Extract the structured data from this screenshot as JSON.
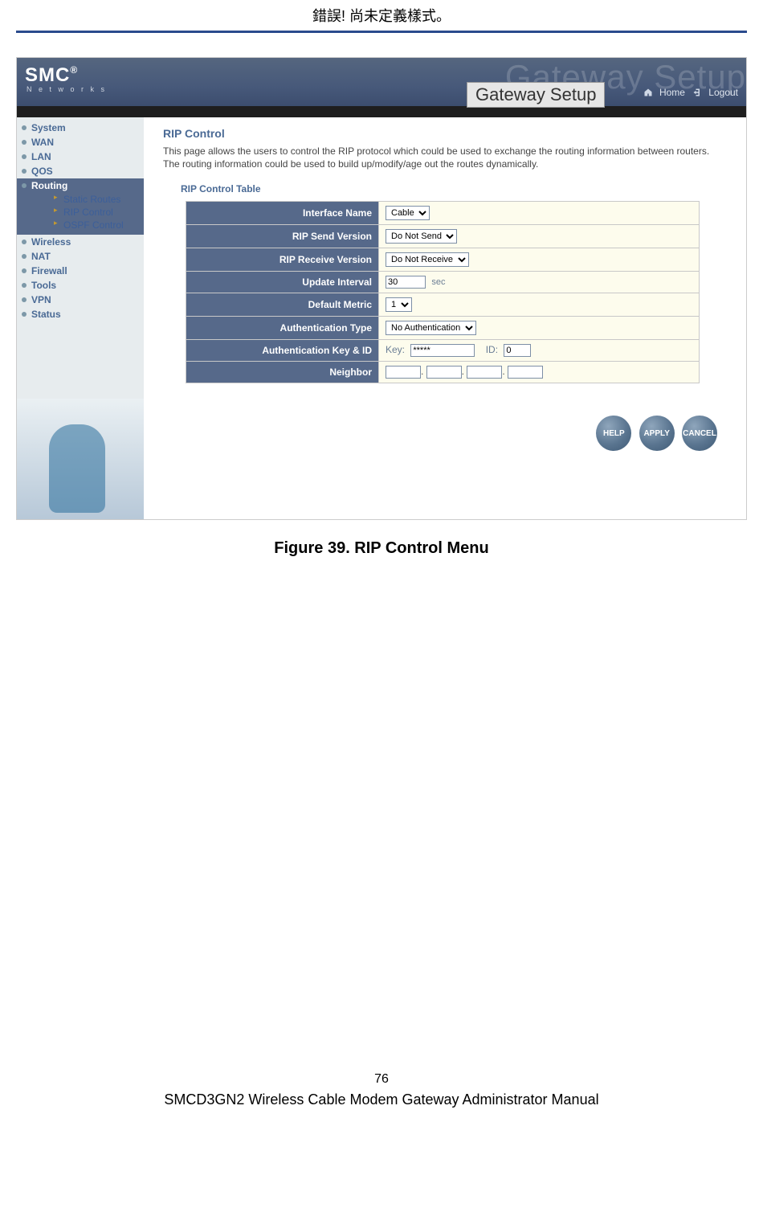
{
  "doc": {
    "topWarning": "錯誤! 尚未定義樣式。",
    "figureCaption": "Figure 39. RIP Control Menu",
    "pageNumber": "76",
    "footerTitle": "SMCD3GN2 Wireless Cable Modem Gateway Administrator Manual"
  },
  "header": {
    "logoMain": "SMC",
    "logoSup": "®",
    "logoSub": "N e t w o r k s",
    "bgTitle": "Gateway Setup",
    "boxTitle": "Gateway Setup",
    "homeLabel": "Home",
    "logoutLabel": "Logout"
  },
  "sidebar": {
    "items": [
      {
        "label": "System"
      },
      {
        "label": "WAN"
      },
      {
        "label": "LAN"
      },
      {
        "label": "QOS"
      },
      {
        "label": "Routing",
        "active": true,
        "sub": [
          {
            "label": "Static Routes"
          },
          {
            "label": "RIP Control"
          },
          {
            "label": "OSPF Control"
          }
        ]
      },
      {
        "label": "Wireless"
      },
      {
        "label": "NAT"
      },
      {
        "label": "Firewall"
      },
      {
        "label": "Tools"
      },
      {
        "label": "VPN"
      },
      {
        "label": "Status"
      }
    ]
  },
  "main": {
    "sectionTitle": "RIP Control",
    "description": "This page allows the users to control the RIP protocol which could be used to exchange the routing information between routers. The routing information could be used to build up/modify/age out the routes dynamically.",
    "tableTitle": "RIP Control Table",
    "rows": {
      "interfaceName": {
        "label": "Interface Name",
        "value": "Cable"
      },
      "ripSend": {
        "label": "RIP Send Version",
        "value": "Do Not Send"
      },
      "ripReceive": {
        "label": "RIP Receive Version",
        "value": "Do Not Receive"
      },
      "updateInterval": {
        "label": "Update Interval",
        "value": "30",
        "unit": "sec"
      },
      "defaultMetric": {
        "label": "Default Metric",
        "value": "1"
      },
      "authType": {
        "label": "Authentication Type",
        "value": "No Authentication"
      },
      "authKeyId": {
        "label": "Authentication Key & ID",
        "keyLabel": "Key:",
        "keyValue": "*****",
        "idLabel": "ID:",
        "idValue": "0"
      },
      "neighbor": {
        "label": "Neighbor",
        "oct1": "",
        "oct2": "",
        "oct3": "",
        "oct4": ""
      }
    },
    "buttons": {
      "help": "HELP",
      "apply": "APPLY",
      "cancel": "CANCEL"
    }
  }
}
